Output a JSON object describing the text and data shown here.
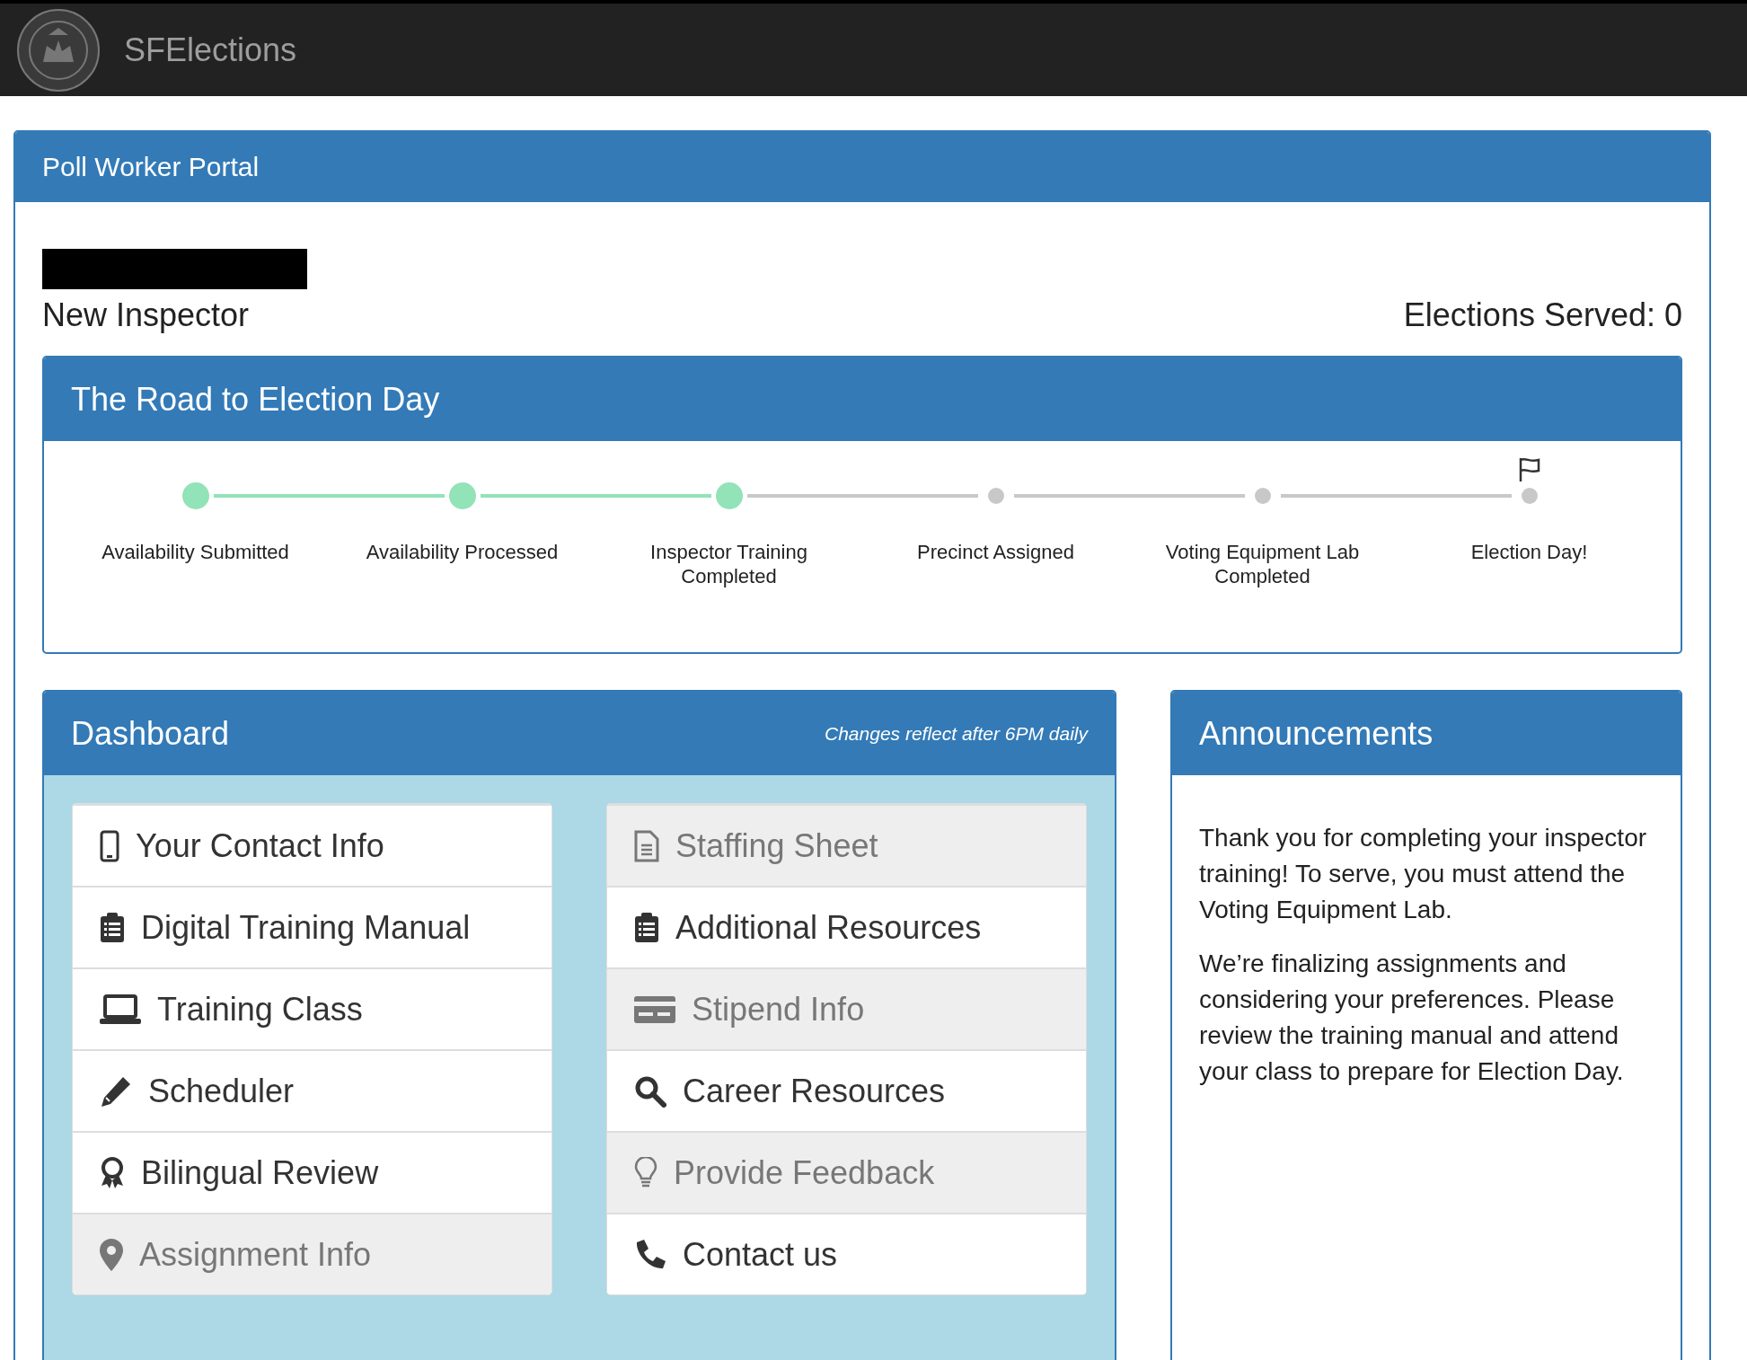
{
  "navbar": {
    "brand": "SFElections"
  },
  "portal": {
    "title": "Poll Worker Portal",
    "role": "New Inspector",
    "elections_served": "Elections Served: 0"
  },
  "road": {
    "title": "The Road to Election Day",
    "steps": [
      {
        "label": "Availability Submitted",
        "completed": true
      },
      {
        "label": "Availability Processed",
        "completed": true
      },
      {
        "label": "Inspector Training Completed",
        "completed": true
      },
      {
        "label": "Precinct Assigned",
        "completed": false
      },
      {
        "label": "Voting Equipment Lab Completed",
        "completed": false
      },
      {
        "label": "Election Day!",
        "completed": false
      }
    ]
  },
  "dashboard": {
    "title": "Dashboard",
    "note": "Changes reflect after 6PM daily",
    "left_items": [
      {
        "label": "Your Contact Info",
        "disabled": false
      },
      {
        "label": "Digital Training Manual",
        "disabled": false
      },
      {
        "label": "Training Class",
        "disabled": false
      },
      {
        "label": "Scheduler",
        "disabled": false
      },
      {
        "label": "Bilingual Review",
        "disabled": false
      },
      {
        "label": "Assignment Info",
        "disabled": true
      }
    ],
    "right_items": [
      {
        "label": "Staffing Sheet",
        "disabled": true
      },
      {
        "label": "Additional Resources",
        "disabled": false
      },
      {
        "label": "Stipend Info",
        "disabled": true
      },
      {
        "label": "Career Resources",
        "disabled": false
      },
      {
        "label": "Provide Feedback",
        "disabled": true
      },
      {
        "label": "Contact us",
        "disabled": false
      }
    ]
  },
  "announcements": {
    "title": "Announcements",
    "paragraphs": [
      "Thank you for completing your inspector training! To serve, you must attend the Voting Equipment Lab.",
      "We’re finalizing assignments and considering your preferences. Please review the training manual and attend your class to prepare for Election Day."
    ]
  }
}
